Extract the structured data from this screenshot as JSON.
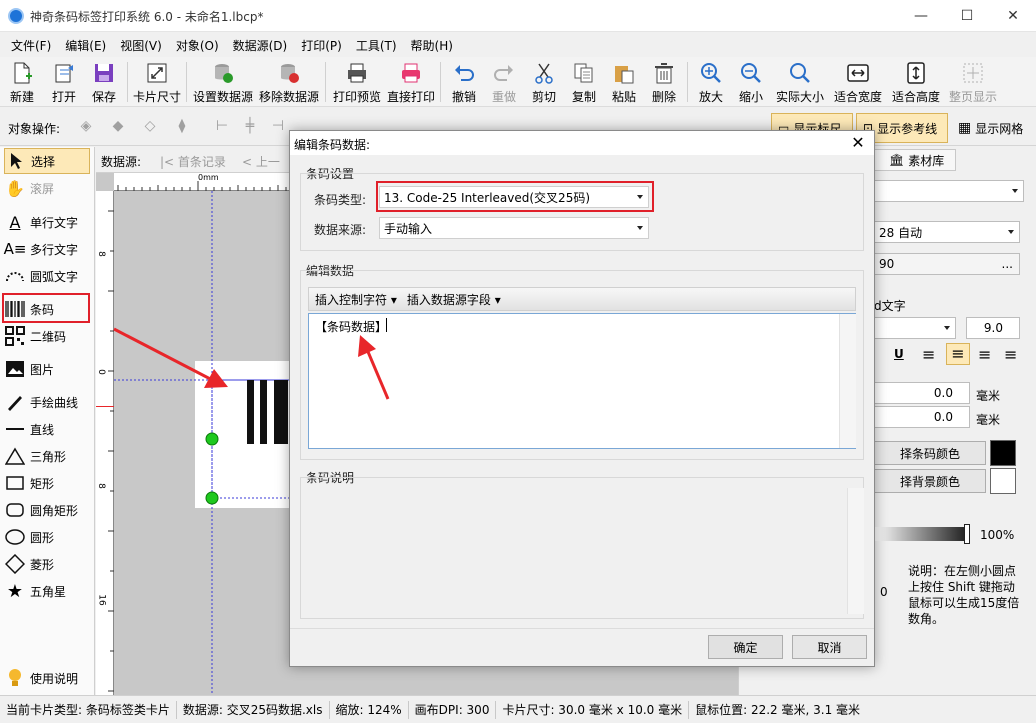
{
  "window": {
    "title": "神奇条码标签打印系统 6.0 - 未命名1.lbcp*",
    "minimize": "—",
    "maximize": "☐",
    "close": "✕"
  },
  "menu": [
    "文件(F)",
    "编辑(E)",
    "视图(V)",
    "对象(O)",
    "数据源(D)",
    "打印(P)",
    "工具(T)",
    "帮助(H)"
  ],
  "toolbar": [
    {
      "label": "新建",
      "icon": "new-file-icon"
    },
    {
      "label": "打开",
      "icon": "open-icon"
    },
    {
      "label": "保存",
      "icon": "save-icon"
    },
    {
      "label": "卡片尺寸",
      "icon": "card-size-icon"
    },
    {
      "label": "设置数据源",
      "icon": "database-set-icon"
    },
    {
      "label": "移除数据源",
      "icon": "database-remove-icon"
    },
    {
      "label": "打印预览",
      "icon": "print-preview-icon"
    },
    {
      "label": "直接打印",
      "icon": "print-icon"
    },
    {
      "label": "撤销",
      "icon": "undo-icon"
    },
    {
      "label": "重做",
      "icon": "redo-icon"
    },
    {
      "label": "剪切",
      "icon": "cut-icon"
    },
    {
      "label": "复制",
      "icon": "copy-icon"
    },
    {
      "label": "粘贴",
      "icon": "paste-icon"
    },
    {
      "label": "删除",
      "icon": "delete-icon"
    },
    {
      "label": "放大",
      "icon": "zoom-in-icon"
    },
    {
      "label": "缩小",
      "icon": "zoom-out-icon"
    },
    {
      "label": "实际大小",
      "icon": "actual-size-icon"
    },
    {
      "label": "适合宽度",
      "icon": "fit-width-icon"
    },
    {
      "label": "适合高度",
      "icon": "fit-height-icon"
    },
    {
      "label": "整页显示",
      "icon": "fit-page-icon"
    }
  ],
  "objbar": {
    "label": "对象操作:",
    "show_ruler": "显示标尺",
    "show_guides": "显示参考线",
    "show_grid": "显示网格"
  },
  "palette": [
    {
      "label": "选择",
      "icon": "cursor-icon"
    },
    {
      "label": "滚屏",
      "icon": "hand-icon"
    },
    {
      "label": "单行文字",
      "icon": "single-text-icon"
    },
    {
      "label": "多行文字",
      "icon": "multi-text-icon"
    },
    {
      "label": "圆弧文字",
      "icon": "arc-text-icon"
    },
    {
      "label": "条码",
      "icon": "barcode-icon"
    },
    {
      "label": "二维码",
      "icon": "qrcode-icon"
    },
    {
      "label": "图片",
      "icon": "image-icon"
    },
    {
      "label": "手绘曲线",
      "icon": "pen-icon"
    },
    {
      "label": "直线",
      "icon": "line-icon"
    },
    {
      "label": "三角形",
      "icon": "triangle-icon"
    },
    {
      "label": "矩形",
      "icon": "rectangle-icon"
    },
    {
      "label": "圆角矩形",
      "icon": "rounded-rect-icon"
    },
    {
      "label": "圆形",
      "icon": "circle-icon"
    },
    {
      "label": "菱形",
      "icon": "diamond-icon"
    },
    {
      "label": "五角星",
      "icon": "star-icon"
    }
  ],
  "help_label": "使用说明",
  "dsbar": {
    "label": "数据源:",
    "first": "首条记录",
    "prev": "上一"
  },
  "ruler": {
    "top_zero": "0mm",
    "left_marks": [
      "8",
      "0",
      "8",
      "16"
    ]
  },
  "rightpanel": {
    "tab_material": "素材库",
    "mode_value": "28 自动",
    "angle_value": "90",
    "ellipsis": "...",
    "text_label": "d文字",
    "font_size": "9.0",
    "offset1": "0.0",
    "offset2": "0.0",
    "unit": "毫米",
    "barcode_color_btn": "择条码颜色",
    "bg_color_btn": "择背景颜色",
    "opacity": "100%",
    "zero": "0",
    "note": "说明：在左侧小圆点上按住 Shift 键拖动鼠标可以生成15度倍数角。"
  },
  "dialog": {
    "title": "编辑条码数据:",
    "barcode_settings": "条码设置",
    "type_label": "条码类型:",
    "type_value": "13.  Code-25 Interleaved(交叉25码)",
    "source_label": "数据来源:",
    "source_value": "手动输入",
    "edit_data": "编辑数据",
    "insert_control": "插入控制字符",
    "insert_field": "插入数据源字段",
    "editor_text": "【条码数据】",
    "description": "条码说明",
    "ok": "确定",
    "cancel": "取消"
  },
  "statusbar": {
    "card_type": "当前卡片类型:  条码标签类卡片",
    "datasource": "数据源: 交叉25码数据.xls",
    "zoom": "缩放: 124%",
    "dpi": "画布DPI: 300",
    "card_size": "卡片尺寸: 30.0 毫米 x 10.0 毫米",
    "mouse_pos": "鼠标位置: 22.2 毫米, 3.1 毫米"
  },
  "colors": {
    "accent_red": "#e0202a",
    "selection_blue": "#3a3ad8",
    "handle_green": "#1ec81e"
  }
}
